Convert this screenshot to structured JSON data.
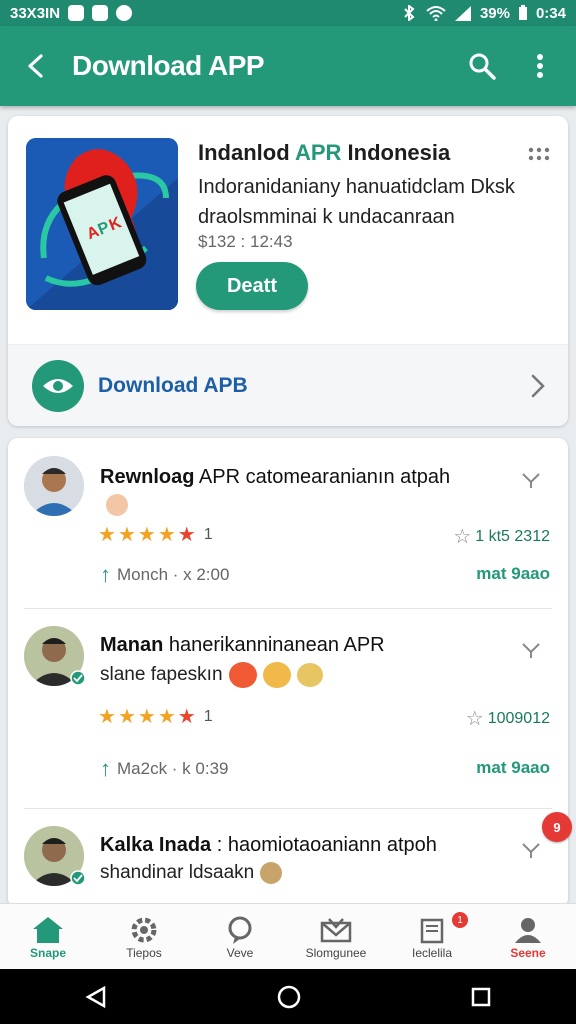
{
  "status_bar": {
    "left_text": "33X3IN",
    "battery": "39%",
    "time": "0:34"
  },
  "app_bar": {
    "title": "Download APP"
  },
  "app": {
    "title_prefix": "Indanlod ",
    "title_accent": "APR",
    "title_suffix": " Indonesia",
    "description": "Indoranidaniany hanuatidclam Dksk draolsmminai k undacanraan",
    "price": "$132 : 12:43",
    "get_button": "Deatt"
  },
  "download_row": {
    "label": "Download APB"
  },
  "reviews": [
    {
      "name_bold": "Rewnloag",
      "name_rest": " APR catomearanianın atpah",
      "subline": "",
      "star_count": "1",
      "votes": "1 kt5 2312",
      "meta": "Monch · x 2:00",
      "reply": "mat 9aao"
    },
    {
      "name_bold": "Manan",
      "name_rest": " hanerikanninanean APR",
      "subline": "slane fapeskın",
      "star_count": "1",
      "votes": "1009012",
      "meta": "Ma2ck · k 0:39",
      "reply": "mat 9aao"
    },
    {
      "name_bold": "Kalka Inada",
      "name_rest": " : haomiotaoaniann atpoh",
      "subline": "shandinar ldsaakn",
      "star_count": "",
      "votes": "",
      "meta": "",
      "reply": ""
    }
  ],
  "notification_badge": "9",
  "bottom_nav": [
    {
      "label": "Snape",
      "icon": "home-icon"
    },
    {
      "label": "Tiepos",
      "icon": "settings-icon"
    },
    {
      "label": "Veve",
      "icon": "chat-icon"
    },
    {
      "label": "Slomgunee",
      "icon": "inbox-icon"
    },
    {
      "label": "Ieclelila",
      "icon": "notes-icon",
      "badge": "1"
    },
    {
      "label": "Seene",
      "icon": "profile-icon"
    }
  ],
  "colors": {
    "primary": "#23997a",
    "status_bar": "#1f8a70",
    "link": "#1d5fa7",
    "star": "#f2a321",
    "alert": "#e53935"
  }
}
